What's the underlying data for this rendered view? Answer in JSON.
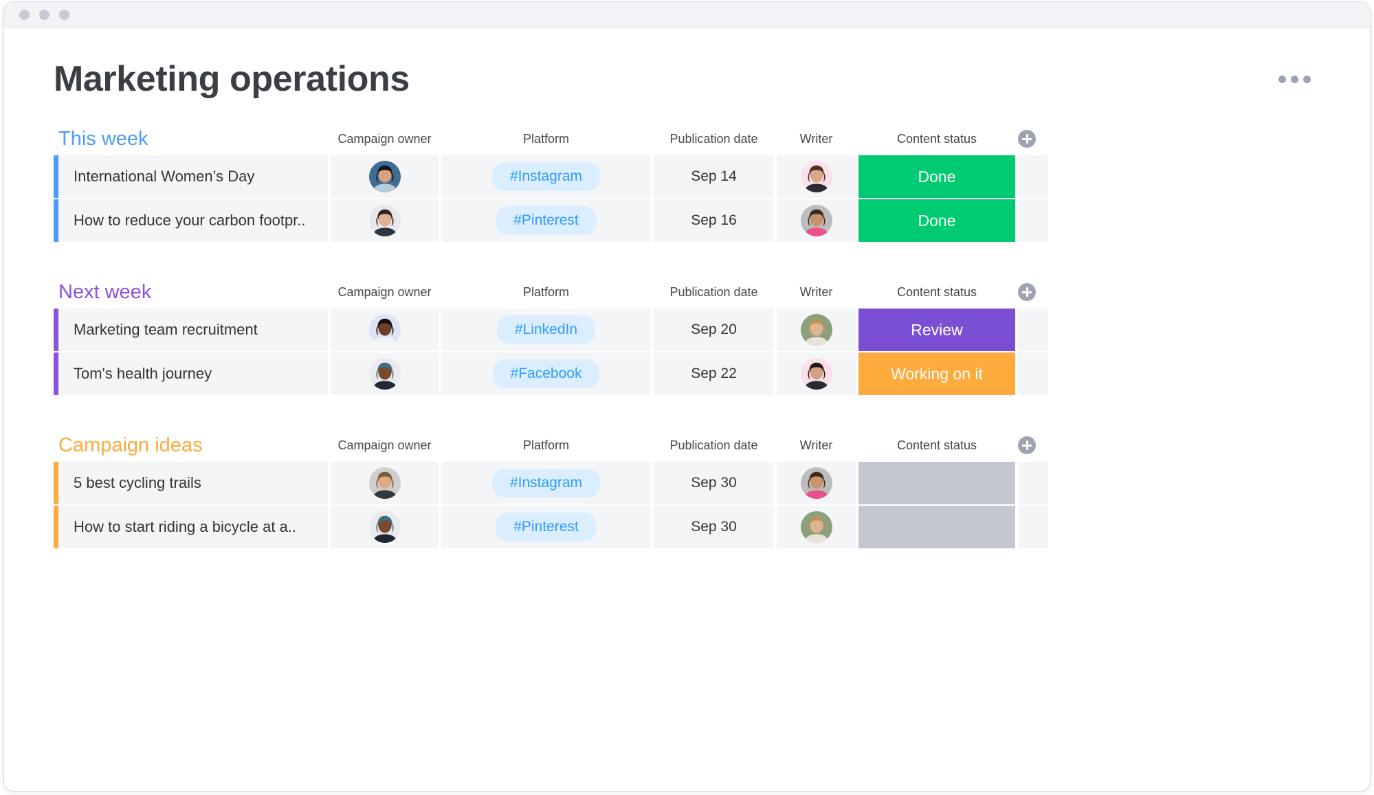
{
  "window": {
    "traffic_lights": [
      "close",
      "minimize",
      "maximize"
    ]
  },
  "header": {
    "title": "Marketing operations",
    "menu_icon": "more-horizontal-icon"
  },
  "columns": [
    "Campaign owner",
    "Platform",
    "Publication date",
    "Writer",
    "Content status"
  ],
  "add_column_label": "+",
  "colors": {
    "this_week": "#4a9cf8",
    "next_week": "#8a52e0",
    "campaign_ideas": "#fdab3d",
    "done": "#00ca72",
    "review": "#7b4fd4",
    "working_on_it": "#fdab3d",
    "empty_status": "#c4c7d0",
    "tag_bg": "#dbeeff",
    "tag_text": "#2f9bff",
    "cell_bg": "#f4f5f7"
  },
  "groups": [
    {
      "title": "This week",
      "color": "#4a9cf8",
      "items": [
        {
          "name": "International Women’s Day",
          "owner_avatar": "woman-dark-hair-beach",
          "platform": "#Instagram",
          "date": "Sep 14",
          "writer_avatar": "woman-brown-hair-pink-bg",
          "status": "Done",
          "status_color": "#00ca72"
        },
        {
          "name": "How to reduce your carbon footpr..",
          "owner_avatar": "woman-updo-hair",
          "platform": "#Pinterest",
          "date": "Sep 16",
          "writer_avatar": "man-beard-floral-shirt",
          "status": "Done",
          "status_color": "#00ca72"
        }
      ]
    },
    {
      "title": "Next week",
      "color": "#8a52e0",
      "items": [
        {
          "name": "Marketing team recruitment",
          "owner_avatar": "woman-glasses-white-shirt",
          "platform": "#LinkedIn",
          "date": "Sep 20",
          "writer_avatar": "woman-blonde-green-bg",
          "status": "Review",
          "status_color": "#7b4fd4"
        },
        {
          "name": "Tom's health journey",
          "owner_avatar": "man-beanie-beard",
          "platform": "#Facebook",
          "date": "Sep 22",
          "writer_avatar": "woman-dark-hair-pink-bg",
          "status": "Working on it",
          "status_color": "#fdab3d"
        }
      ]
    },
    {
      "title": "Campaign ideas",
      "color": "#fdab3d",
      "items": [
        {
          "name": "5 best cycling trails",
          "owner_avatar": "man-short-hair-gray-bg",
          "platform": "#Instagram",
          "date": "Sep 30",
          "writer_avatar": "man-beard-floral-shirt",
          "status": "",
          "status_color": "#c4c7d0"
        },
        {
          "name": "How to start riding a bicycle at a..",
          "owner_avatar": "man-beanie-beard",
          "platform": "#Pinterest",
          "date": "Sep 30",
          "writer_avatar": "woman-blonde-green-bg",
          "status": "",
          "status_color": "#c4c7d0"
        }
      ]
    }
  ]
}
